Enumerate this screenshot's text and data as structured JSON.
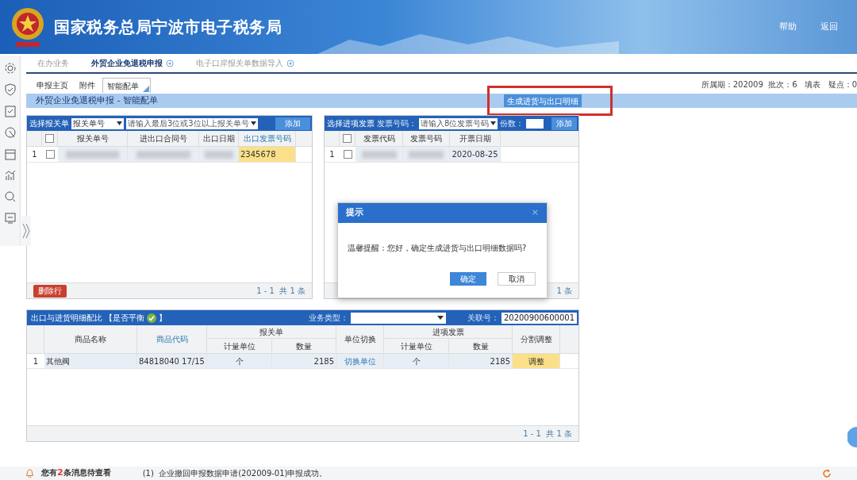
{
  "header": {
    "title": "国家税务总局宁波市电子税务局",
    "links": [
      "帮助",
      "返回"
    ]
  },
  "tabs": [
    {
      "label": "在办业务",
      "selected": false,
      "closable": false
    },
    {
      "label": "外贸企业免退税申报",
      "selected": true,
      "closable": true
    },
    {
      "label": "电子口岸报关单数据导入",
      "selected": false,
      "closable": true
    }
  ],
  "subtabs": [
    {
      "label": "申报主页",
      "selected": false
    },
    {
      "label": "附件",
      "selected": false
    },
    {
      "label": "智能配单",
      "selected": true
    }
  ],
  "period_info": "所属期：202009  批次：6   填表   疑点：0",
  "section_title": "外贸企业免退税申报 - 智能配单",
  "generate_button": "生成进货与出口明细",
  "declaration_panel": {
    "title": "选择报关单",
    "type_select": "报关单号",
    "search_placeholder": "请输入最后3位或3位以上报关单号",
    "add_button": "添加",
    "columns": [
      "报关单号",
      "进出口合同号",
      "出口日期",
      "出口发票号码"
    ],
    "header_checked": false,
    "rows": [
      {
        "index": "1",
        "checked": false,
        "cells": [
          "",
          "",
          "",
          "2345678"
        ]
      }
    ],
    "delete_button": "删除行",
    "pager": "1 - 1  共 1 条"
  },
  "invoice_panel": {
    "title": "选择进项发票",
    "number_label": "发票号码：",
    "number_placeholder": "请输入8位发票号码",
    "count_label": "份数：",
    "add_button": "添加",
    "columns": [
      "发票代码",
      "发票号码",
      "开票日期"
    ],
    "header_checked": false,
    "rows": [
      {
        "index": "1",
        "checked": false,
        "cells": [
          "",
          "",
          "2020-08-25"
        ]
      }
    ],
    "pager": "1 条"
  },
  "dialog": {
    "title": "提示",
    "close": "×",
    "message": "温馨提醒：您好，确定生成进货与出口明细数据吗?",
    "buttons": [
      "确定",
      "取消"
    ]
  },
  "match_panel": {
    "title": "出口与进货明细配比 【是否平衡",
    "title_end": "】",
    "balanced": true,
    "business_type_label": "业务类型：",
    "link_label": "关联号：",
    "link_value": "20200900600001",
    "group_headers": [
      "报关单",
      "进项发票"
    ],
    "columns": [
      "商品名称",
      "商品代码",
      "计量单位",
      "数量",
      "单位切换",
      "计量单位",
      "数量",
      "分割调整"
    ],
    "rows": [
      {
        "index": "1",
        "cells": [
          "其他阀",
          "84818040 17/15",
          "个",
          "2185",
          "切换单位",
          "个",
          "2185",
          "调整"
        ]
      }
    ],
    "pager": "1 - 1  共 1 条"
  },
  "footer": {
    "notice_pre": "您有",
    "notice_count": "2",
    "notice_post": "条消息待查看",
    "message": "(1)  企业撤回申报数据申请(202009-01)申报成功。"
  }
}
